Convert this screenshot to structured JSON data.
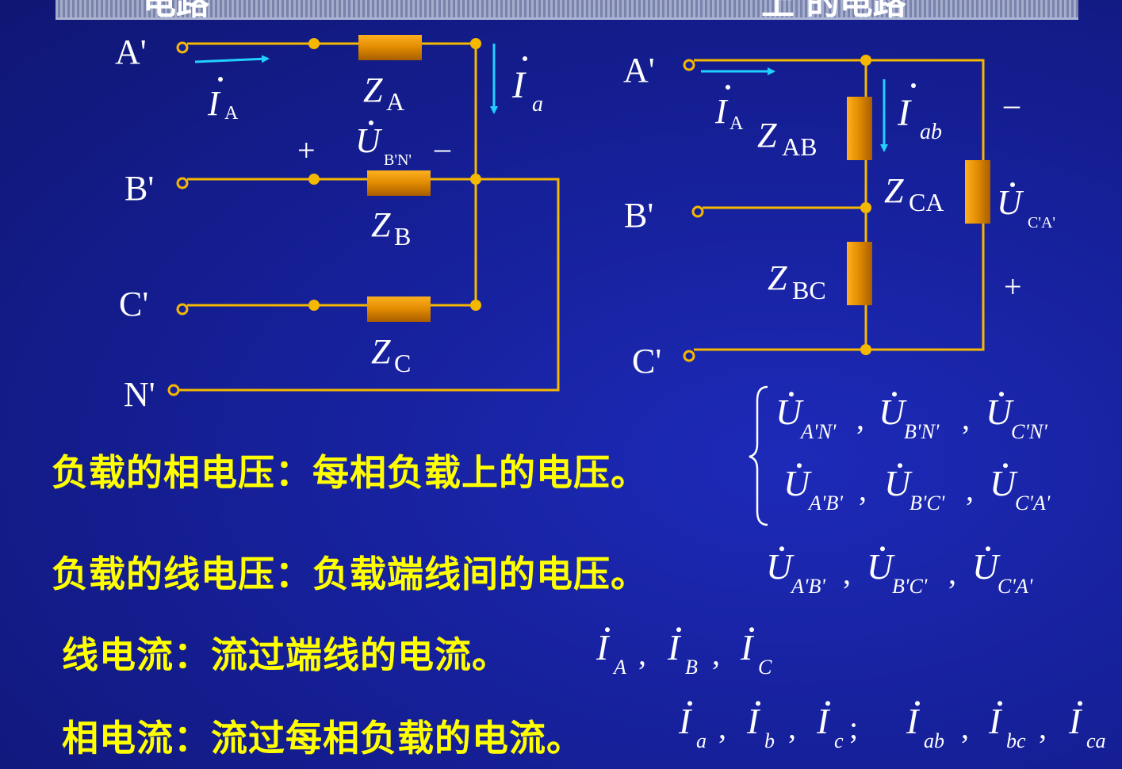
{
  "header_fragments": {
    "left": "电路",
    "right": "上 的电路"
  },
  "y_circuit": {
    "terminals": {
      "a": "A'",
      "b": "B'",
      "c": "C'",
      "n": "N'"
    },
    "line_current": {
      "sym": "I",
      "sub": "A"
    },
    "phase_current": {
      "sym": "I",
      "sub": "a"
    },
    "impedances": [
      {
        "sym": "Z",
        "sub": "A"
      },
      {
        "sym": "Z",
        "sub": "B"
      },
      {
        "sym": "Z",
        "sub": "C"
      }
    ],
    "voltage": {
      "sym": "U",
      "sub": "B'N'",
      "plus": "+",
      "minus": "–"
    }
  },
  "delta_circuit": {
    "terminals": {
      "a": "A'",
      "b": "B'",
      "c": "C'"
    },
    "line_current": {
      "sym": "I",
      "sub": "A"
    },
    "phase_current": {
      "sym": "I",
      "sub": "ab"
    },
    "impedances": [
      {
        "sym": "Z",
        "sub": "AB"
      },
      {
        "sym": "Z",
        "sub": "CA"
      },
      {
        "sym": "Z",
        "sub": "BC"
      }
    ],
    "voltage": {
      "sym": "U",
      "sub": "C'A'",
      "plus": "+",
      "minus": "–"
    }
  },
  "definitions": [
    {
      "label": "负载的相电压：每相负载上的电压。"
    },
    {
      "label": "负载的线电压：负载端线间的电压。"
    },
    {
      "label": "线电流：流过端线的电流。"
    },
    {
      "label": "相电流：流过每相负载的电流。"
    }
  ],
  "formulas": {
    "phase_voltage_y": [
      {
        "sym": "U",
        "sub": "A'N'"
      },
      {
        "sym": "U",
        "sub": "B'N'"
      },
      {
        "sym": "U",
        "sub": "C'N'"
      }
    ],
    "phase_voltage_delta": [
      {
        "sym": "U",
        "sub": "A'B'"
      },
      {
        "sym": "U",
        "sub": "B'C'"
      },
      {
        "sym": "U",
        "sub": "C'A'"
      }
    ],
    "line_voltage": [
      {
        "sym": "U",
        "sub": "A'B'"
      },
      {
        "sym": "U",
        "sub": "B'C'"
      },
      {
        "sym": "U",
        "sub": "C'A'"
      }
    ],
    "line_current": [
      {
        "sym": "I",
        "sub": "A"
      },
      {
        "sym": "I",
        "sub": "B"
      },
      {
        "sym": "I",
        "sub": "C"
      }
    ],
    "phase_current_y": [
      {
        "sym": "I",
        "sub": "a"
      },
      {
        "sym": "I",
        "sub": "b"
      },
      {
        "sym": "I",
        "sub": "c"
      }
    ],
    "phase_current_delta": [
      {
        "sym": "I",
        "sub": "ab"
      },
      {
        "sym": "I",
        "sub": "bc"
      },
      {
        "sym": "I",
        "sub": "ca"
      }
    ]
  },
  "colors": {
    "wire": "#f5b800",
    "resistor": "#e08a00",
    "arrow": "#22d0ff",
    "text": "#ffffff",
    "label": "#ffff00"
  }
}
